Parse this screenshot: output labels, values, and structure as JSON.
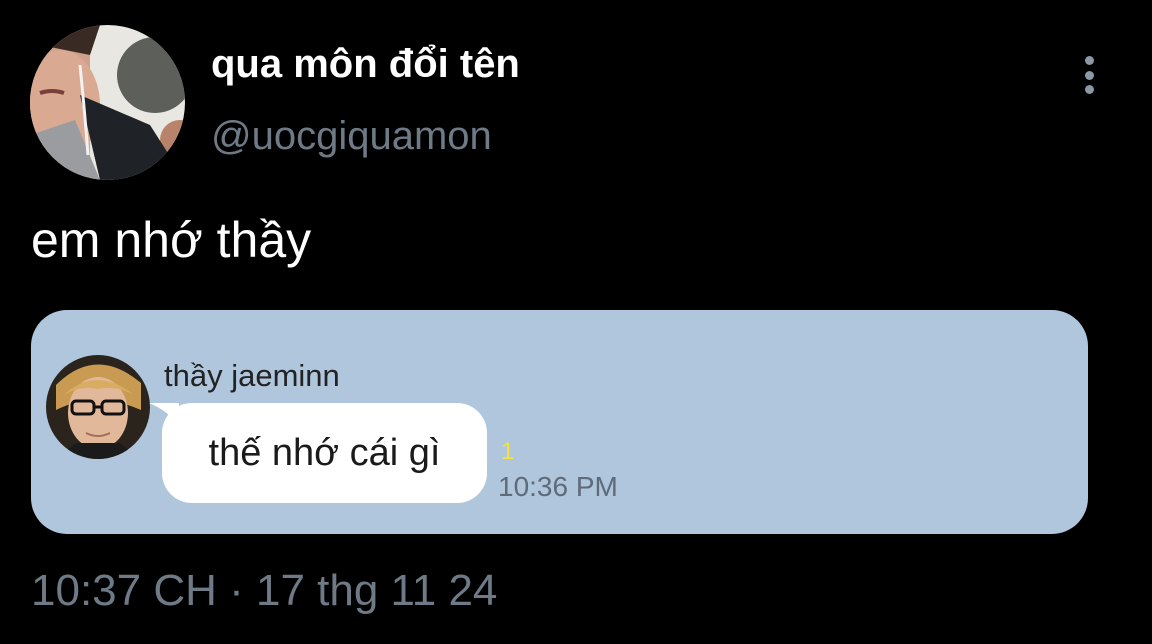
{
  "colors": {
    "background": "#000000",
    "primary_text": "#ffffff",
    "secondary_text": "#6e7a86",
    "card_background": "#afc6dd",
    "bubble_background": "#ffffff",
    "unread_count": "#f4e23a"
  },
  "author": {
    "display_name": "qua môn đổi tên",
    "handle": "@uocgiquamon",
    "avatar_icon": "profile-photo"
  },
  "more_button": {
    "icon": "more-vertical-icon"
  },
  "tweet": {
    "text": "em nhớ thầy"
  },
  "media": {
    "sender_name": "thầy jaeminn",
    "sender_avatar_icon": "profile-photo",
    "message_text": "thế nhớ cái gì",
    "unread_count": "1",
    "message_time": "10:36 PM"
  },
  "footer": {
    "timestamp": "10:37 CH · 17 thg 11 24"
  }
}
